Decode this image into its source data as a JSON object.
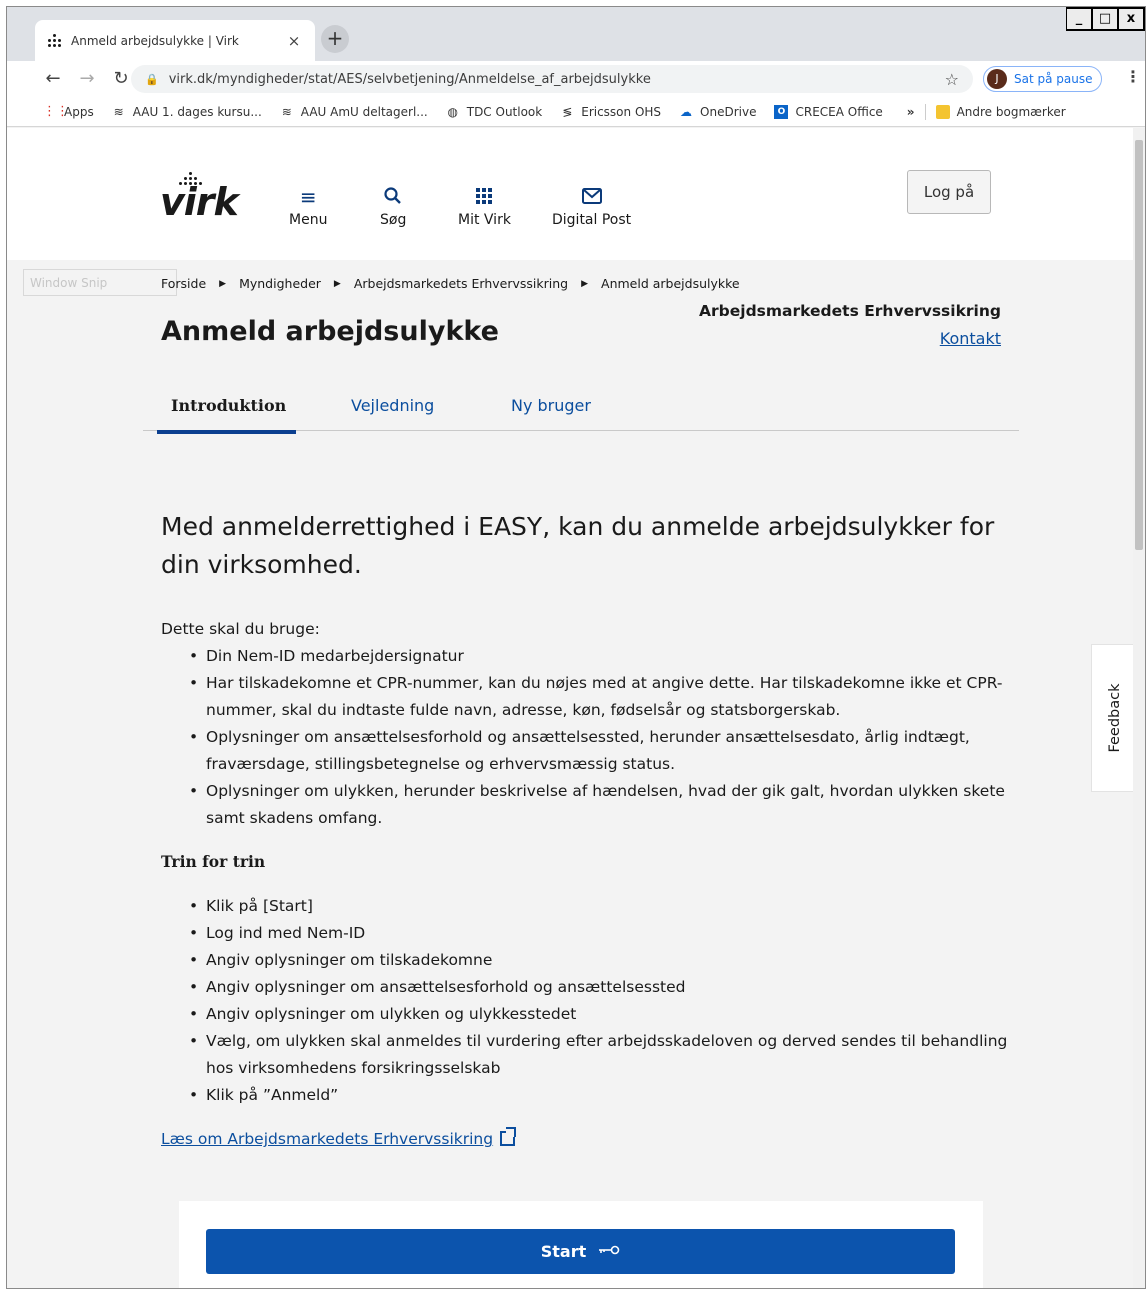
{
  "browser": {
    "tab_title": "Anmeld arbejdsulykke | Virk",
    "tab_close": "×",
    "new_tab": "+",
    "url": "virk.dk/myndigheder/stat/AES/selvbetjening/Anmeldelse_af_arbejdsulykke",
    "profile_initial": "J",
    "profile_label": "Sat på pause",
    "window_controls": [
      "_",
      "□",
      "x"
    ],
    "bookmarks": [
      {
        "label": "Apps",
        "icon": "apps-grid-icon"
      },
      {
        "label": "AAU 1. dages kursu...",
        "icon": "stack-icon"
      },
      {
        "label": "AAU AmU deltagerl...",
        "icon": "stack-icon"
      },
      {
        "label": "TDC Outlook",
        "icon": "globe-icon"
      },
      {
        "label": "Ericsson OHS",
        "icon": "ericsson-icon"
      },
      {
        "label": "OneDrive",
        "icon": "cloud-icon"
      },
      {
        "label": "CRECEA Office",
        "icon": "outlook-icon"
      }
    ],
    "bookmarks_more": "»",
    "other_bookmarks": "Andre bogmærker"
  },
  "header": {
    "logo": "virk",
    "nav": [
      {
        "label": "Menu",
        "icon": "menu-icon"
      },
      {
        "label": "Søg",
        "icon": "search-icon"
      },
      {
        "label": "Mit Virk",
        "icon": "grid-icon"
      },
      {
        "label": "Digital Post",
        "icon": "mail-icon"
      }
    ],
    "login_label": "Log på"
  },
  "overlay": {
    "window_snip": "Window Snip"
  },
  "breadcrumb": [
    "Forside",
    "Myndigheder",
    "Arbejdsmarkedets Erhvervssikring",
    "Anmeld arbejdsulykke"
  ],
  "authority": {
    "name": "Arbejdsmarkedets Erhvervssikring",
    "contact": "Kontakt"
  },
  "page_title": "Anmeld arbejdsulykke",
  "tabs": [
    "Introduktion",
    "Vejledning",
    "Ny bruger"
  ],
  "content": {
    "lead": "Med anmelderrettighed i EASY, kan du anmelde arbejdsulykker for din virksomhed.",
    "requirements_intro": "Dette skal du bruge:",
    "requirements": [
      "Din Nem-ID medarbejdersignatur",
      "Har tilskadekomne et CPR-nummer, kan du nøjes med at angive dette. Har tilskadekomne ikke et CPR-nummer, skal du indtaste fulde navn, adresse, køn, fødselsår og statsborgerskab.",
      "Oplysninger om ansættelsesforhold og ansættelsessted, herunder ansættelsesdato, årlig indtægt, fraværsdage, stillingsbetegnelse og erhvervsmæssig status.",
      "Oplysninger om ulykken, herunder beskrivelse af hændelsen, hvad der gik galt, hvordan ulykken skete samt skadens omfang."
    ],
    "steps_heading": "Trin for trin",
    "steps": [
      "Klik på [Start]",
      "Log ind med Nem-ID",
      "Angiv oplysninger om tilskadekomne",
      "Angiv oplysninger om ansættelsesforhold og ansættelsessted",
      "Angiv oplysninger om ulykken og ulykkesstedet",
      "Vælg, om ulykken skal anmeldes til vurdering efter arbejdsskadeloven og derved sendes til behandling hos virksomhedens forsikringsselskab",
      "Klik på ”Anmeld”"
    ],
    "read_more_link": "Læs om Arbejdsmarkedets Erhvervssikring"
  },
  "start_button": "Start",
  "feedback_tab": "Feedback",
  "colors": {
    "primary": "#0c54ad",
    "link": "#0b4e9e",
    "background": "#f3f3f3"
  }
}
